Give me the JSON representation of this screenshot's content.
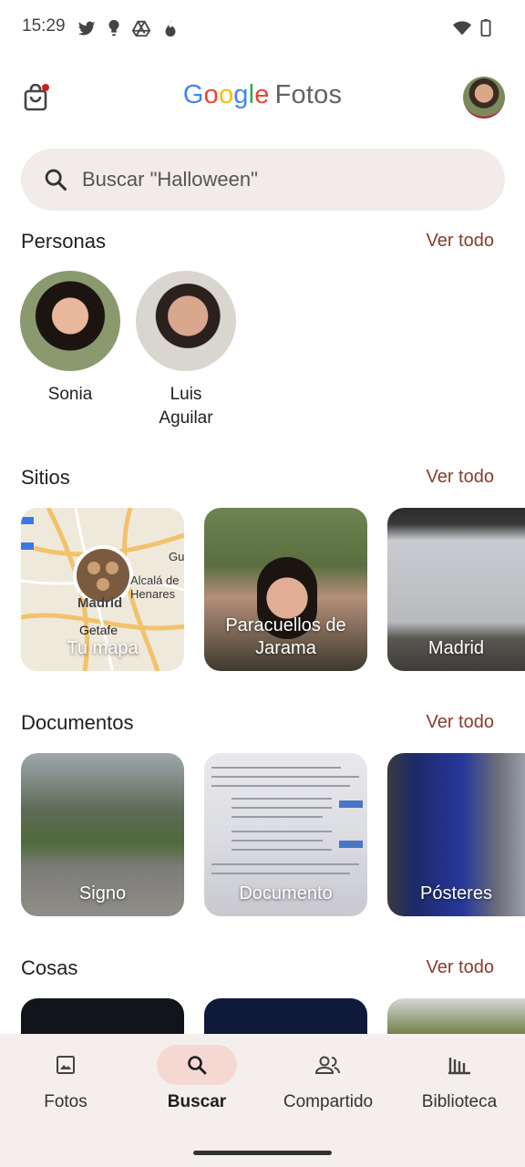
{
  "status_bar": {
    "time": "15:29",
    "icons": [
      "twitter-icon",
      "bulb-icon",
      "drive-icon",
      "fire-icon",
      "wifi-icon",
      "battery-icon"
    ]
  },
  "header": {
    "logo_letters": [
      "G",
      "o",
      "o",
      "g",
      "l",
      "e"
    ],
    "logo_suffix": "Fotos",
    "icons": [
      "shopping-bag-icon",
      "profile-avatar"
    ],
    "colors": {
      "blue": "#4285F4",
      "red": "#EA4335",
      "yellow": "#FBBC05",
      "green": "#34A853"
    }
  },
  "search": {
    "placeholder": "Buscar \"Halloween\""
  },
  "sections": {
    "people": {
      "title": "Personas",
      "see_all": "Ver todo",
      "items": [
        {
          "name": "Sonia"
        },
        {
          "name": "Luis\nAguilar"
        }
      ]
    },
    "places": {
      "title": "Sitios",
      "see_all": "Ver todo",
      "items": [
        {
          "label": "Tu mapa"
        },
        {
          "label": "Paracuellos de\nJarama"
        },
        {
          "label": "Madrid"
        }
      ],
      "map_labels": [
        "Alcalá de\nHenares",
        "Madrid",
        "Getafe",
        "Gua"
      ]
    },
    "documents": {
      "title": "Documentos",
      "see_all": "Ver todo",
      "items": [
        {
          "label": "Signo"
        },
        {
          "label": "Documento"
        },
        {
          "label": "Pósteres"
        }
      ]
    },
    "things": {
      "title": "Cosas",
      "see_all": "Ver todo"
    }
  },
  "bottom_nav": {
    "items": [
      {
        "label": "Fotos",
        "icon": "photo-icon",
        "active": false
      },
      {
        "label": "Buscar",
        "icon": "search-icon",
        "active": true
      },
      {
        "label": "Compartido",
        "icon": "people-icon",
        "active": false
      },
      {
        "label": "Biblioteca",
        "icon": "library-icon",
        "active": false
      }
    ],
    "active_color": "#f6d8d2"
  },
  "accent_color": "#8a3b2e"
}
